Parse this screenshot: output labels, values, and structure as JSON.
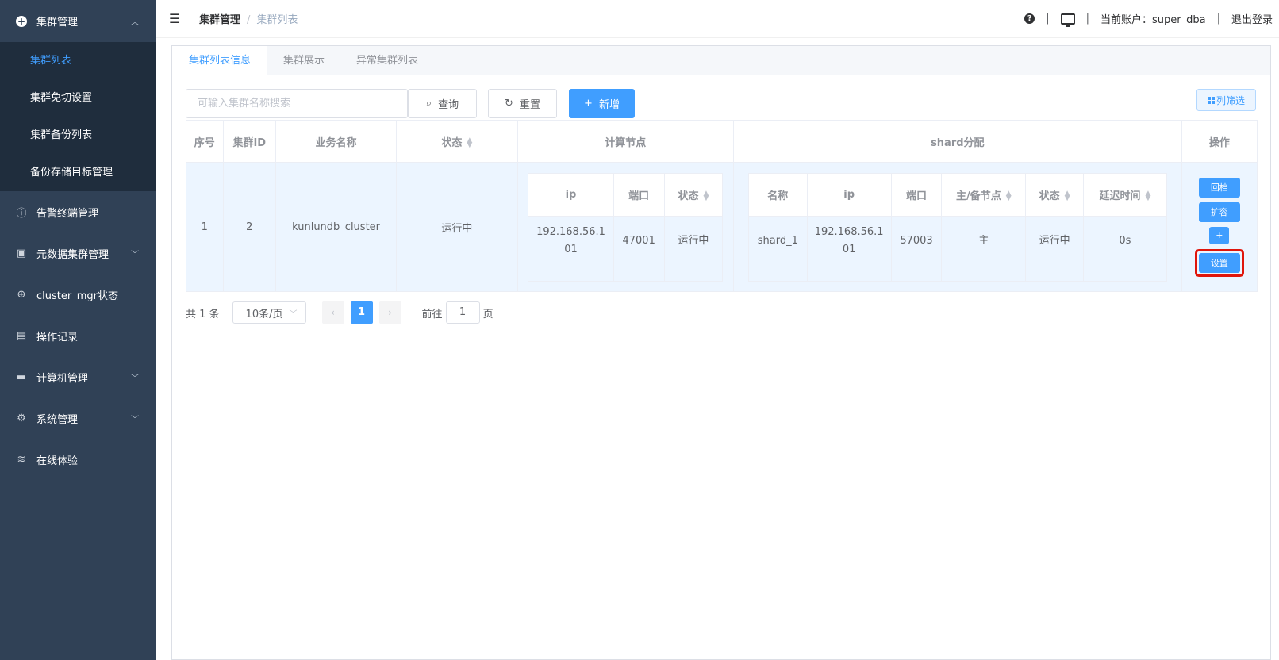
{
  "sidebar": {
    "group": {
      "label": "集群管理",
      "icon": "plus-circle-icon"
    },
    "subitems": [
      "集群列表",
      "集群免切设置",
      "集群备份列表",
      "备份存储目标管理"
    ],
    "items": [
      {
        "label": "告警终端管理",
        "icon": "alert-circle-icon",
        "has_caret": false
      },
      {
        "label": "元数据集群管理",
        "icon": "metadata-icon",
        "has_caret": true
      },
      {
        "label": "cluster_mgr状态",
        "icon": "crosshair-icon",
        "has_caret": false
      },
      {
        "label": "操作记录",
        "icon": "record-icon",
        "has_caret": false
      },
      {
        "label": "计算机管理",
        "icon": "computer-icon",
        "has_caret": true
      },
      {
        "label": "系统管理",
        "icon": "gear-icon",
        "has_caret": true
      },
      {
        "label": "在线体验",
        "icon": "database-icon",
        "has_caret": false
      }
    ]
  },
  "header": {
    "breadcrumb": [
      "集群管理",
      "集群列表"
    ],
    "account_label": "当前账户：super_dba",
    "logout": "退出登录"
  },
  "tabs": [
    "集群列表信息",
    "集群展示",
    "异常集群列表"
  ],
  "toolbar": {
    "search_placeholder": "可输入集群名称搜索",
    "query": "查询",
    "reset": "重置",
    "add": "新增",
    "filter": "列筛选"
  },
  "table": {
    "headers": {
      "seq": "序号",
      "id": "集群ID",
      "biz": "业务名称",
      "status": "状态",
      "compute": "计算节点",
      "shard": "shard分配",
      "ops": "操作"
    },
    "row": {
      "seq": "1",
      "id": "2",
      "biz": "kunlundb_cluster",
      "status": "运行中"
    },
    "compute_headers": {
      "ip": "ip",
      "port": "端口",
      "status": "状态"
    },
    "compute_row": {
      "ip": "192.168.56.101",
      "port": "47001",
      "status": "运行中"
    },
    "shard_headers": {
      "name": "名称",
      "ip": "ip",
      "port": "端口",
      "role": "主/备节点",
      "status": "状态",
      "delay": "延迟时间"
    },
    "shard_row": {
      "name": "shard_1",
      "ip": "192.168.56.101",
      "port": "57003",
      "role": "主",
      "status": "运行中",
      "delay": "0s"
    },
    "ops": {
      "rollback": "回档",
      "expand": "扩容",
      "plus": "+",
      "settings": "设置"
    }
  },
  "pagination": {
    "total": "共 1 条",
    "page_size": "10条/页",
    "current": "1",
    "goto_prefix": "前往",
    "goto_value": "1",
    "goto_suffix": "页"
  },
  "colors": {
    "sidebar": "#304156",
    "submenu": "#1f2d3d",
    "accent": "#409eff",
    "running": "#67c23a",
    "highlight_box": "#e0160c"
  }
}
